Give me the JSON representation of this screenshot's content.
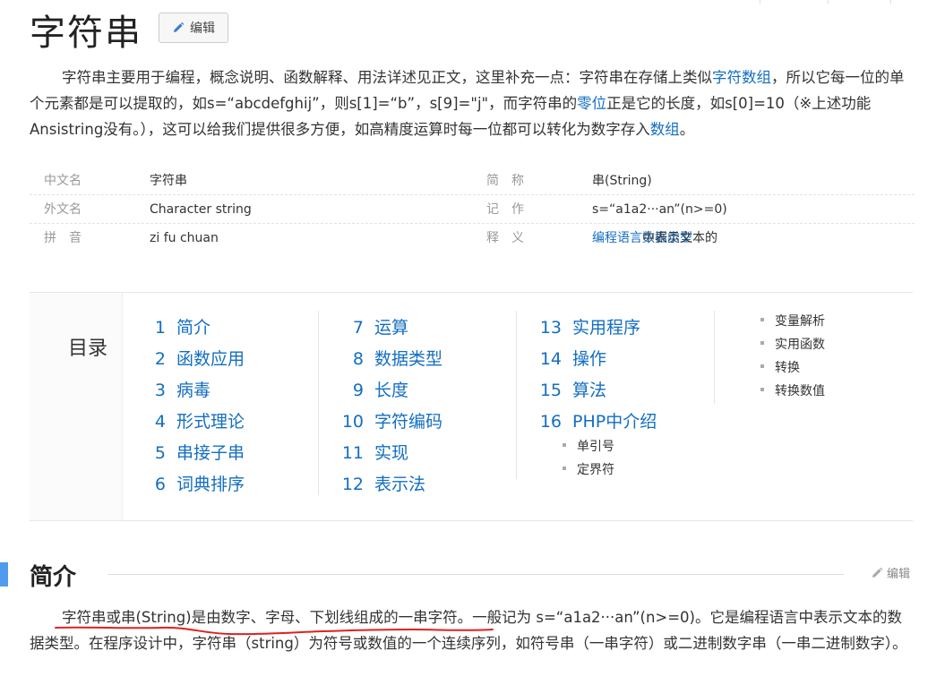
{
  "title": "字符串",
  "edit_label": "编辑",
  "intro": {
    "p1": "字符串主要用于编程，概念说明、函数解释、用法详述见正文，这里补充一点：字符串在存储上类似",
    "link1": "字符数组",
    "p2": "，所以它每一位的单个元素都是可以提取的，如s=“abcdefghij”，则s[1]=“b”，s[9]=\"j\"，而字符串的",
    "link2": "零位",
    "p3": "正是它的长度，如s[0]=10（※上述功能Ansistring没有。），这可以给我们提供很多方便，如高精度运算时每一位都可以转化为数字存入",
    "link3": "数组",
    "p4": "。"
  },
  "basic_info": [
    {
      "k": "中文名",
      "v": "字符串",
      "k2": "简　称",
      "v2": "串(String)"
    },
    {
      "k": "外文名",
      "v": "Character string",
      "k2": "记　作",
      "v2": "s=“a1a2···an”(n>=0)"
    },
    {
      "k": "拼　音",
      "v": "zi fu chuan",
      "k2": "释　义",
      "v2_link1": "编程语言",
      "v2_mid": "中表示文本的",
      "v2_link2": "数据类型"
    }
  ],
  "catalog": {
    "title": "目录",
    "col1": [
      {
        "num": "1",
        "label": "简介"
      },
      {
        "num": "2",
        "label": "函数应用"
      },
      {
        "num": "3",
        "label": "病毒"
      },
      {
        "num": "4",
        "label": "形式理论"
      },
      {
        "num": "5",
        "label": "串接子串"
      },
      {
        "num": "6",
        "label": "词典排序"
      }
    ],
    "col2": [
      {
        "num": "7",
        "label": "运算"
      },
      {
        "num": "8",
        "label": "数据类型"
      },
      {
        "num": "9",
        "label": "长度"
      },
      {
        "num": "10",
        "label": "字符编码"
      },
      {
        "num": "11",
        "label": "实现"
      },
      {
        "num": "12",
        "label": "表示法"
      }
    ],
    "col3": [
      {
        "num": "13",
        "label": "实用程序"
      },
      {
        "num": "14",
        "label": "操作"
      },
      {
        "num": "15",
        "label": "算法"
      },
      {
        "num": "16",
        "label": "PHP中介绍"
      }
    ],
    "col3_sub": [
      "单引号",
      "定界符"
    ],
    "col4_sub": [
      "变量解析",
      "实用函数",
      "转换",
      "转换数值"
    ]
  },
  "section": {
    "title": "简介",
    "edit_label": "编辑",
    "body_underlined": "字符串或串(String)是由数字、字母、下划线组成的一串字符",
    "body_rest": "。一般记为 s=“a1a2···an”(n>=0)。它是编程语言中表示文本的数据类型。在程序设计中，字符串（string）为符号或数值的一个连续序列，如符号串（一串字符）或二进制数字串（一串二进制数字）。"
  },
  "colors": {
    "link": "#136ec2",
    "section_bar": "#4f9cee",
    "underline": "#e02020"
  }
}
